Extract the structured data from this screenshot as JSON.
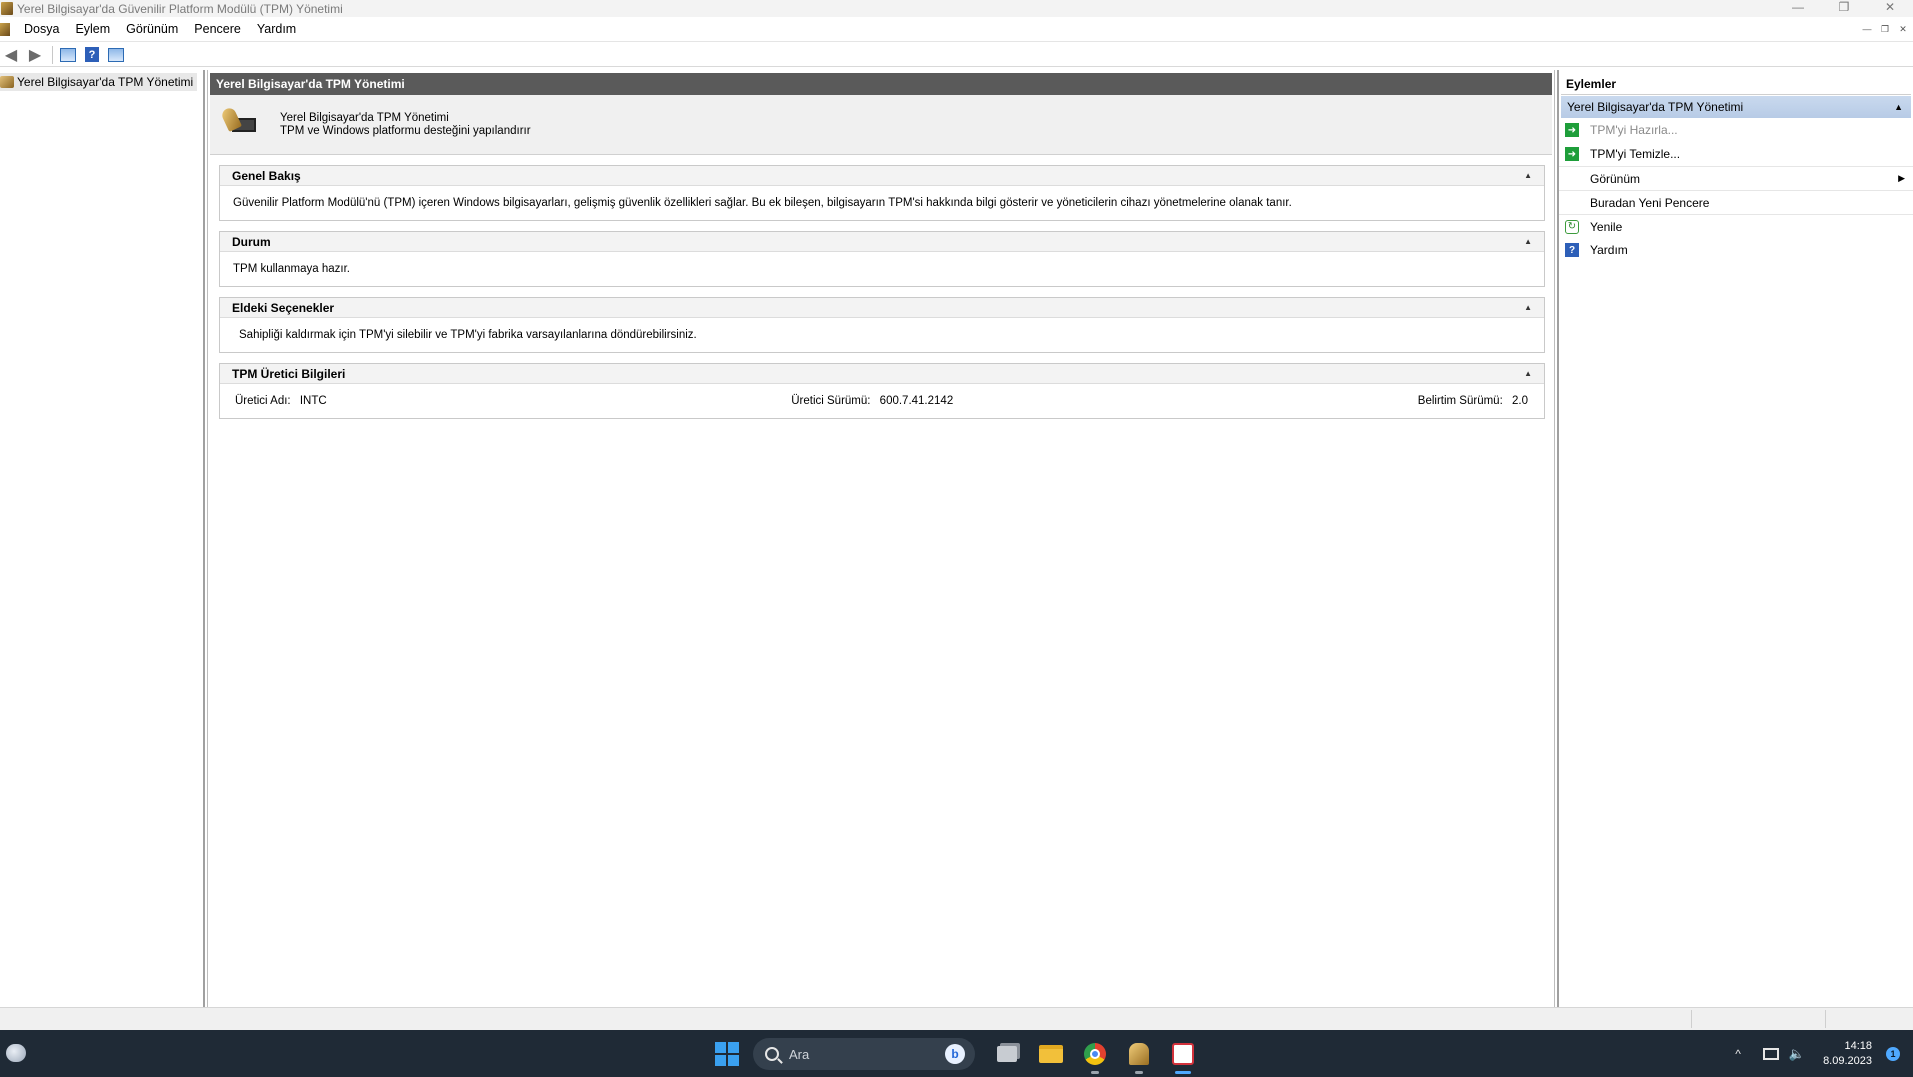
{
  "window": {
    "title": "Yerel Bilgisayar'da Güvenilir Platform Modülü (TPM) Yönetimi",
    "controls": {
      "minimize": "—",
      "restore": "❐",
      "close": "✕"
    }
  },
  "menu": {
    "items": [
      "Dosya",
      "Eylem",
      "Görünüm",
      "Pencere",
      "Yardım"
    ],
    "mdi": {
      "minimize": "—",
      "restore": "❐",
      "close": "✕"
    }
  },
  "toolbar": {
    "back_icon": "back-arrow-icon",
    "forward_icon": "forward-arrow-icon",
    "help_glyph": "?"
  },
  "tree": {
    "root_label": "Yerel Bilgisayar'da TPM Yönetimi"
  },
  "center": {
    "header": "Yerel Bilgisayar'da TPM Yönetimi",
    "banner_line1": "Yerel Bilgisayar'da TPM Yönetimi",
    "banner_line2": "TPM ve Windows platformu desteğini yapılandırır",
    "sections": {
      "overview": {
        "title": "Genel Bakış",
        "body": "Güvenilir Platform Modülü'nü (TPM) içeren Windows bilgisayarları, gelişmiş güvenlik özellikleri sağlar. Bu ek bileşen, bilgisayarın TPM'si hakkında bilgi gösterir ve yöneticilerin cihazı yönetmelerine olanak tanır."
      },
      "status": {
        "title": "Durum",
        "body": "TPM kullanmaya hazır."
      },
      "options": {
        "title": "Eldeki Seçenekler",
        "body": "Sahipliği kaldırmak için TPM'yi silebilir ve TPM'yi fabrika varsayılanlarına döndürebilirsiniz."
      },
      "manufacturer": {
        "title": "TPM Üretici Bilgileri",
        "name_label": "Üretici Adı:",
        "name_value": "INTC",
        "version_label": "Üretici Sürümü:",
        "version_value": "600.7.41.2142",
        "spec_label": "Belirtim Sürümü:",
        "spec_value": "2.0"
      }
    },
    "collapse_glyph": "▲"
  },
  "actions": {
    "header": "Eylemler",
    "group": "Yerel Bilgisayar'da TPM Yönetimi",
    "items": [
      {
        "label": "TPM'yi Hazırla...",
        "icon": "green-arrow-icon",
        "disabled": true
      },
      {
        "label": "TPM'yi Temizle...",
        "icon": "green-arrow-icon",
        "disabled": false
      },
      {
        "label": "Görünüm",
        "icon": "none",
        "submenu": true
      },
      {
        "label": "Buradan Yeni Pencere",
        "icon": "none"
      },
      {
        "label": "Yenile",
        "icon": "refresh-icon"
      },
      {
        "label": "Yardım",
        "icon": "help-icon"
      }
    ]
  },
  "taskbar": {
    "search_placeholder": "Ara",
    "bing_glyph": "b",
    "tray_chevron": "^",
    "time": "14:18",
    "date": "8.09.2023",
    "notification_count": "1"
  }
}
